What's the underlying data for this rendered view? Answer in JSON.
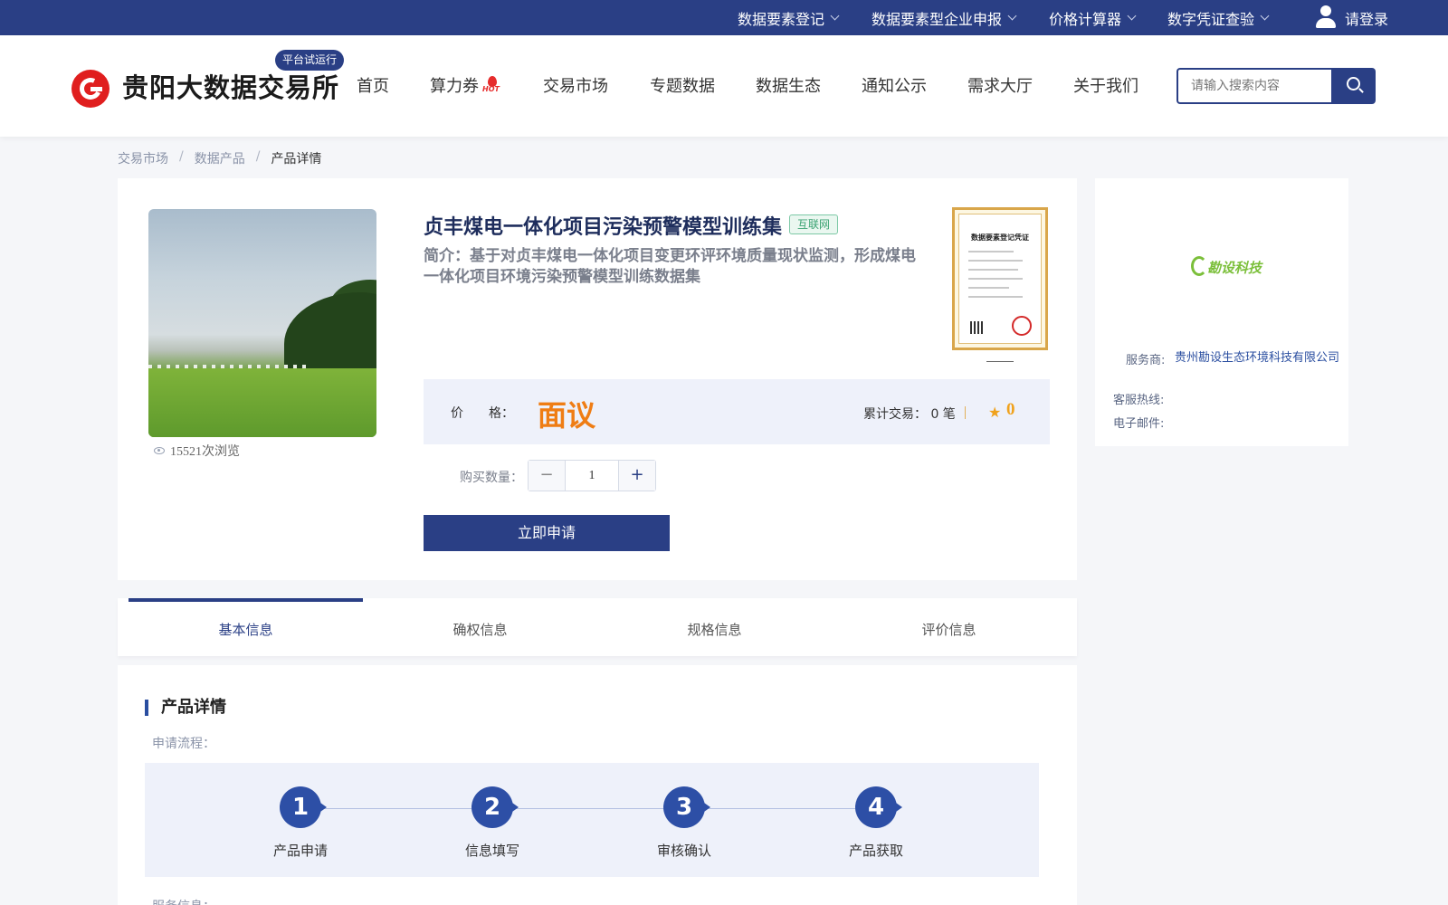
{
  "topbar": {
    "menus": [
      {
        "label": "数据要素登记"
      },
      {
        "label": "数据要素型企业申报"
      },
      {
        "label": "价格计算器"
      },
      {
        "label": "数字凭证查验"
      }
    ],
    "login_label": "请登录"
  },
  "header": {
    "logo_text": "贵阳大数据交易所",
    "trial_badge": "平台试运行",
    "nav": [
      "首页",
      "算力券",
      "交易市场",
      "专题数据",
      "数据生态",
      "通知公示",
      "需求大厅",
      "关于我们"
    ],
    "hot_label": "HOT",
    "search_placeholder": "请输入搜索内容"
  },
  "breadcrumb": [
    "交易市场",
    "数据产品",
    "产品详情"
  ],
  "product": {
    "title": "贞丰煤电一体化项目污染预警模型训练集",
    "tag": "互联网",
    "desc": "简介：基于对贞丰煤电一体化项目变更环评环境质量现状监测，形成煤电一体化项目环境污染预警模型训练数据集",
    "views": "15521次浏览",
    "cert_title": "数据要素登记凭证",
    "price_label": "价　　格：",
    "price_value": "面议",
    "trade_text": "累计交易： 0 笔",
    "rating": "0",
    "qty_label": "购买数量：",
    "qty_value": "1",
    "apply_label": "立即申请"
  },
  "service": {
    "logo_text": "勘设科技",
    "provider_label": "服务商:",
    "provider_value": "贵州勘设生态环境科技有限公司",
    "hotline_label": "客服热线:",
    "email_label": "电子邮件:"
  },
  "tabs": [
    {
      "label": "基本信息",
      "active": true
    },
    {
      "label": "确权信息",
      "active": false
    },
    {
      "label": "规格信息",
      "active": false
    },
    {
      "label": "评价信息",
      "active": false
    }
  ],
  "detail": {
    "heading": "产品详情",
    "flow_label": "申请流程：",
    "steps": [
      {
        "num": "1",
        "label": "产品申请"
      },
      {
        "num": "2",
        "label": "信息填写"
      },
      {
        "num": "3",
        "label": "审核确认"
      },
      {
        "num": "4",
        "label": "产品获取"
      }
    ],
    "service_info_label": "服务信息："
  },
  "colors": {
    "brand": "#2a3f85",
    "accent_orange": "#ef7d14",
    "logo_red": "#e01e1e"
  }
}
